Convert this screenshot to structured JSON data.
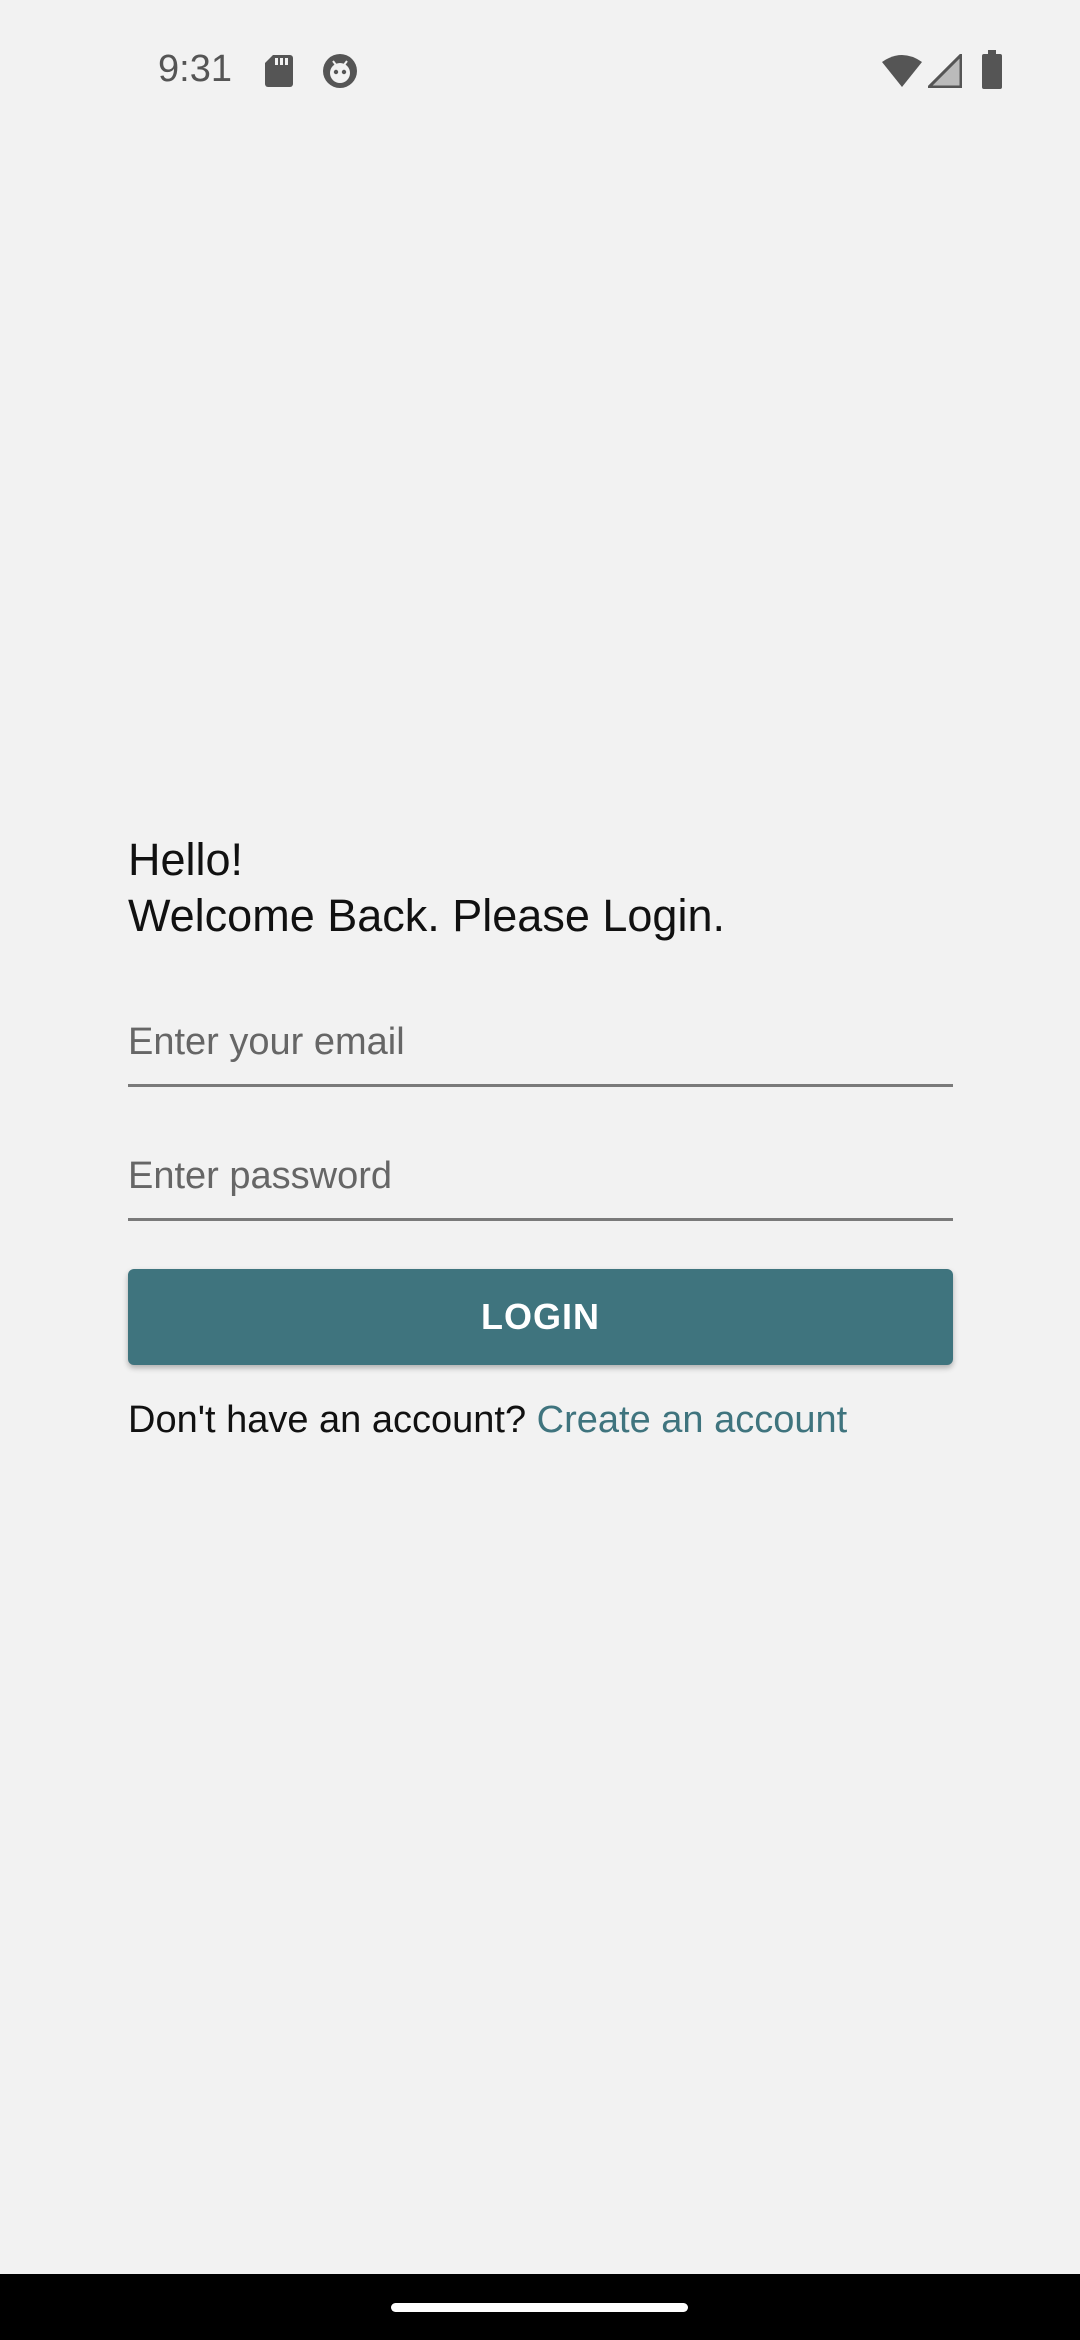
{
  "status_bar": {
    "time": "9:31",
    "left_icons": [
      "sd-card-icon",
      "robot-face-icon"
    ],
    "right_icons": [
      "wifi-icon",
      "cell-signal-icon",
      "battery-icon"
    ]
  },
  "login": {
    "greeting_line1": "Hello!",
    "greeting_line2": "Welcome Back. Please Login.",
    "email_placeholder": "Enter your email",
    "email_value": "",
    "password_placeholder": "Enter password",
    "password_value": "",
    "login_button_label": "LOGIN",
    "signup_prompt": "Don't have an account?",
    "signup_link_label": "Create an account"
  },
  "colors": {
    "background": "#f2f2f2",
    "accent": "#3f747e",
    "nav_bar": "#000000"
  }
}
